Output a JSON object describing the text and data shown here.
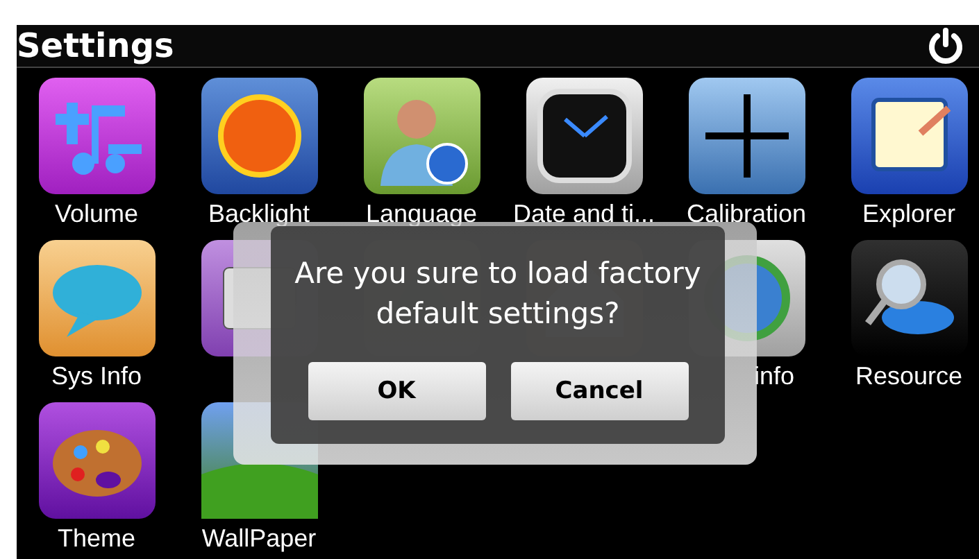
{
  "header": {
    "title": "Settings"
  },
  "items": [
    {
      "label": "Volume",
      "kind": "volume"
    },
    {
      "label": "Backlight",
      "kind": "sun"
    },
    {
      "label": "Language",
      "kind": "person"
    },
    {
      "label": "Date and ti...",
      "kind": "clock"
    },
    {
      "label": "Calibration",
      "kind": "crosshair"
    },
    {
      "label": "Explorer",
      "kind": "document"
    },
    {
      "label": "Sys Info",
      "kind": "speech"
    },
    {
      "kind": "drive"
    },
    {
      "kind": "map"
    },
    {
      "kind": "house"
    },
    {
      "label": "info",
      "kind": "globe"
    },
    {
      "label": "Resource",
      "kind": "magnifier"
    },
    {
      "label": "Theme",
      "kind": "palette"
    },
    {
      "label": "WallPaper",
      "kind": "landscape"
    }
  ],
  "dialog": {
    "message": "Are you sure to load factory default settings?",
    "buttons": [
      "OK",
      "Cancel"
    ]
  }
}
